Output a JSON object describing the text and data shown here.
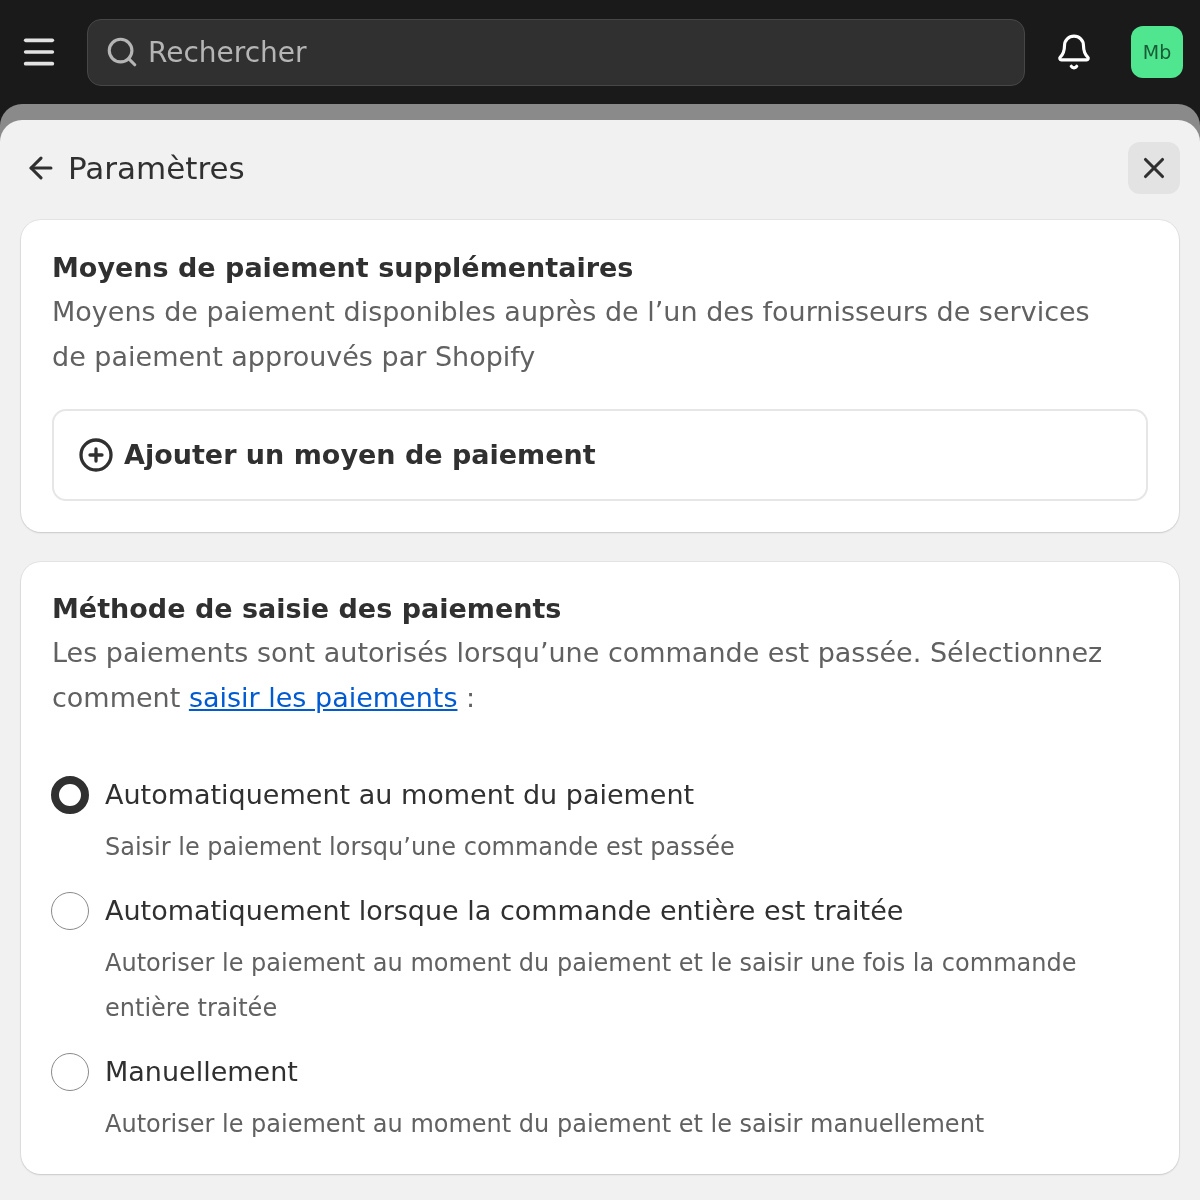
{
  "top_bar": {
    "search": {
      "placeholder": "Rechercher"
    },
    "avatar": {
      "initials": "Mb"
    }
  },
  "header": {
    "title": "Paramètres"
  },
  "sections": [
    {
      "kind": "action",
      "title": "Moyens de paiement supplémentaires",
      "description": "Moyens de paiement disponibles auprès de l’un des fournisseurs de services de paiement approuvés par Shopify",
      "button": {
        "label": "Ajouter un moyen de paiement"
      }
    },
    {
      "kind": "options",
      "title": "Méthode de saisie des paiements",
      "description": {
        "before": "Les paiements sont autorisés lorsqu’une commande est passée. Sélectionnez comment",
        "link": "saisir les paiements",
        "after": ":"
      },
      "options": [
        {
          "label": "Automatiquement au moment du paiement",
          "help": "Saisir le paiement lorsqu’une commande est passée",
          "selected": true
        },
        {
          "label": "Automatiquement lorsque la commande entière est traitée",
          "help": "Autoriser le paiement au moment du paiement et le saisir une fois la commande entière traitée",
          "selected": false
        },
        {
          "label": "Manuellement",
          "help": "Autoriser le paiement au moment du paiement et le saisir manuellement",
          "selected": false
        }
      ]
    }
  ]
}
